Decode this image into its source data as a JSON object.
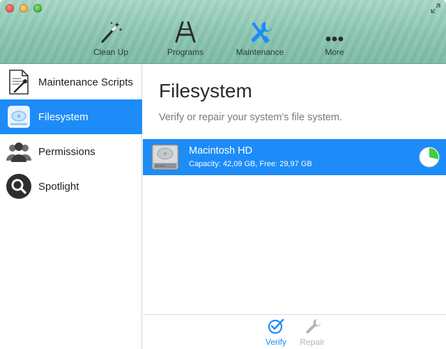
{
  "toolbar": {
    "items": [
      {
        "label": "Clean Up",
        "icon": "magic-wand-icon"
      },
      {
        "label": "Programs",
        "icon": "app-store-icon"
      },
      {
        "label": "Maintenance",
        "icon": "wrench-screwdriver-icon"
      },
      {
        "label": "More",
        "icon": "ellipsis-icon"
      }
    ],
    "active_color": "#1d8cf8"
  },
  "sidebar": {
    "items": [
      {
        "label": "Maintenance Scripts",
        "icon": "script-document-icon"
      },
      {
        "label": "Filesystem",
        "icon": "hard-disk-icon",
        "selected": true
      },
      {
        "label": "Permissions",
        "icon": "users-icon"
      },
      {
        "label": "Spotlight",
        "icon": "magnifier-icon"
      }
    ]
  },
  "main": {
    "title": "Filesystem",
    "subtitle": "Verify or repair your system's file system.",
    "disks": [
      {
        "name": "Macintosh HD",
        "capacity_text": "Capacity: 42,09 GB, Free: 29,97 GB",
        "capacity_gb": 42.09,
        "free_gb": 29.97,
        "selected": true
      }
    ]
  },
  "actions": {
    "verify_label": "Verify",
    "repair_label": "Repair"
  },
  "colors": {
    "selection": "#1d8cf8",
    "toolbar_bg": "#8ac5b1",
    "pie_used": "#3dcf3d"
  }
}
